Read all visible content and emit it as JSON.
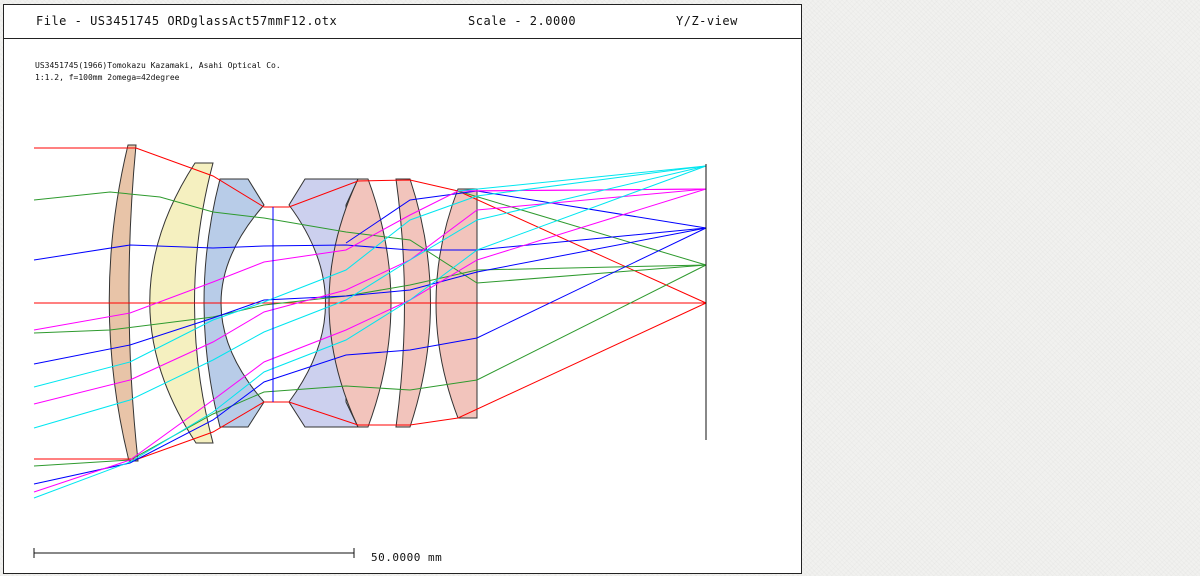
{
  "header": {
    "file_label": "File - US3451745 ORDglassAct57mmF12.otx",
    "scale_label": "Scale - 2.0000",
    "view_label": "Y/Z-view"
  },
  "description": {
    "line1": "US3451745(1966)Tomokazu Kazamaki, Asahi Optical Co.",
    "line2": "1:1.2, f=100mm 2omega=42degree"
  },
  "scale_bar": {
    "label": "50.0000 mm"
  },
  "colors": {
    "lens_orange": "#e8c4a8",
    "lens_yellow": "#f5f0c0",
    "lens_blue": "#b8cce8",
    "lens_lavender": "#ccd0ee",
    "lens_pink": "#f2c4bc",
    "ray_red": "#ff0000",
    "ray_green": "#2e9a2e",
    "ray_blue": "#0000ff",
    "ray_magenta": "#ff00ff",
    "ray_cyan": "#00e6f0"
  }
}
